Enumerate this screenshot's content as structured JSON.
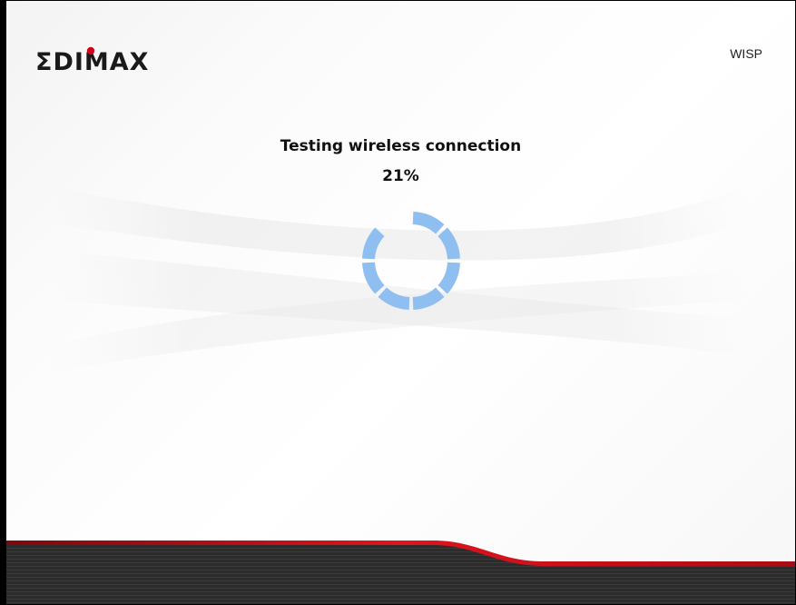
{
  "brand": {
    "logo_text": "EDIMAX",
    "logo_colors": {
      "text": "#1a1a1a",
      "dot": "#d0021b"
    }
  },
  "header": {
    "mode_label": "WISP"
  },
  "status": {
    "title": "Testing wireless connection",
    "percent_text": "21%",
    "progress": 0.21
  },
  "spinner": {
    "icon": "loading-spinner-icon",
    "color": "#8fbef0",
    "segments": 8
  },
  "theme": {
    "footer_dark": "#2b2b2b",
    "footer_accent": "#c8101a"
  }
}
